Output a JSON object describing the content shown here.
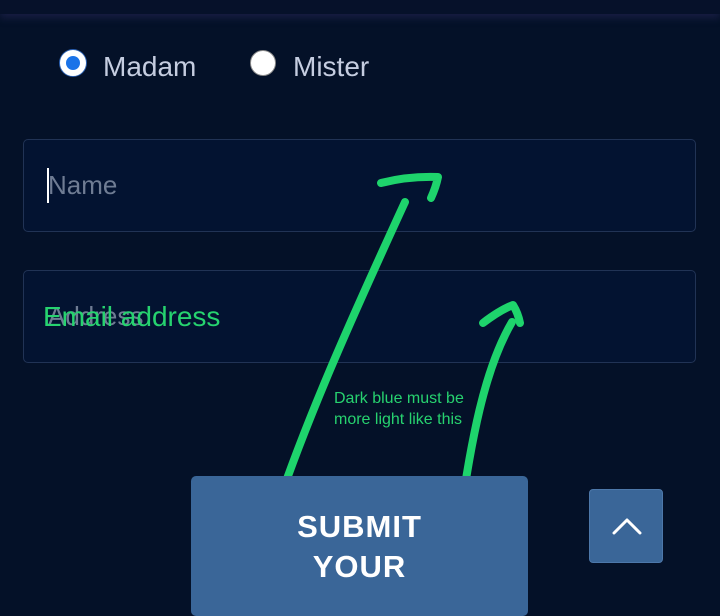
{
  "gender": {
    "options": [
      {
        "label": "Madam",
        "selected": true
      },
      {
        "label": "Mister",
        "selected": false
      }
    ]
  },
  "form": {
    "name_placeholder": "Name",
    "address_placeholder": "Address",
    "address_overlay": "Email address",
    "submit_line1": "SUBMIT",
    "submit_line2": "YOUR"
  },
  "annotation": {
    "note": "Dark blue must be more light like this"
  },
  "icons": {
    "scroll_top": "chevron-up-icon"
  },
  "colors": {
    "background": "#041128",
    "field_background": "#031331",
    "button": "#3a6698",
    "radio_accent": "#1a73e8",
    "annotation": "#27d26f"
  }
}
